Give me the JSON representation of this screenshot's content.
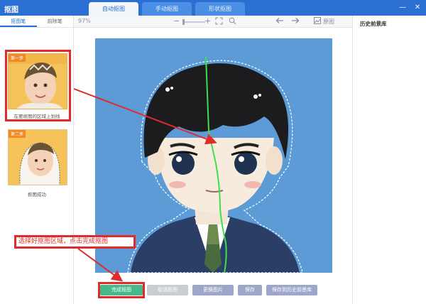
{
  "window": {
    "title": "抠图",
    "minimize": "—",
    "close": "✕"
  },
  "tabs": [
    {
      "label": "自动抠图",
      "active": true
    },
    {
      "label": "手动抠图",
      "active": false
    },
    {
      "label": "形状抠图",
      "active": false
    }
  ],
  "left_panel": {
    "tabs": [
      {
        "label": "抠图笔",
        "active": true
      },
      {
        "label": "前除笔",
        "active": false
      }
    ],
    "steps": [
      {
        "badge": "第一步",
        "caption": "在要抠图的区域上划线"
      },
      {
        "badge": "第二步",
        "caption": "抠图成功"
      }
    ]
  },
  "toolbar": {
    "zoom": "97%",
    "zoom_out": "−",
    "zoom_in": "+",
    "undo_icon": "undo-arrow-icon",
    "redo_icon": "redo-arrow-icon",
    "original_label": "原图"
  },
  "right_panel": {
    "title": "历史前景库"
  },
  "annotation": "选择好抠图区域，点击完成抠图",
  "buttons": {
    "done": "完成抠图",
    "cancel": "取消抠图",
    "replace": "更换图片",
    "save": "保存",
    "save_history": "保存到历史前景库"
  },
  "colors": {
    "titlebar": "#2a6fd1",
    "canvas_bg": "#5c9bd6",
    "highlight_red": "#e12b2b",
    "done_green": "#45b98a"
  }
}
